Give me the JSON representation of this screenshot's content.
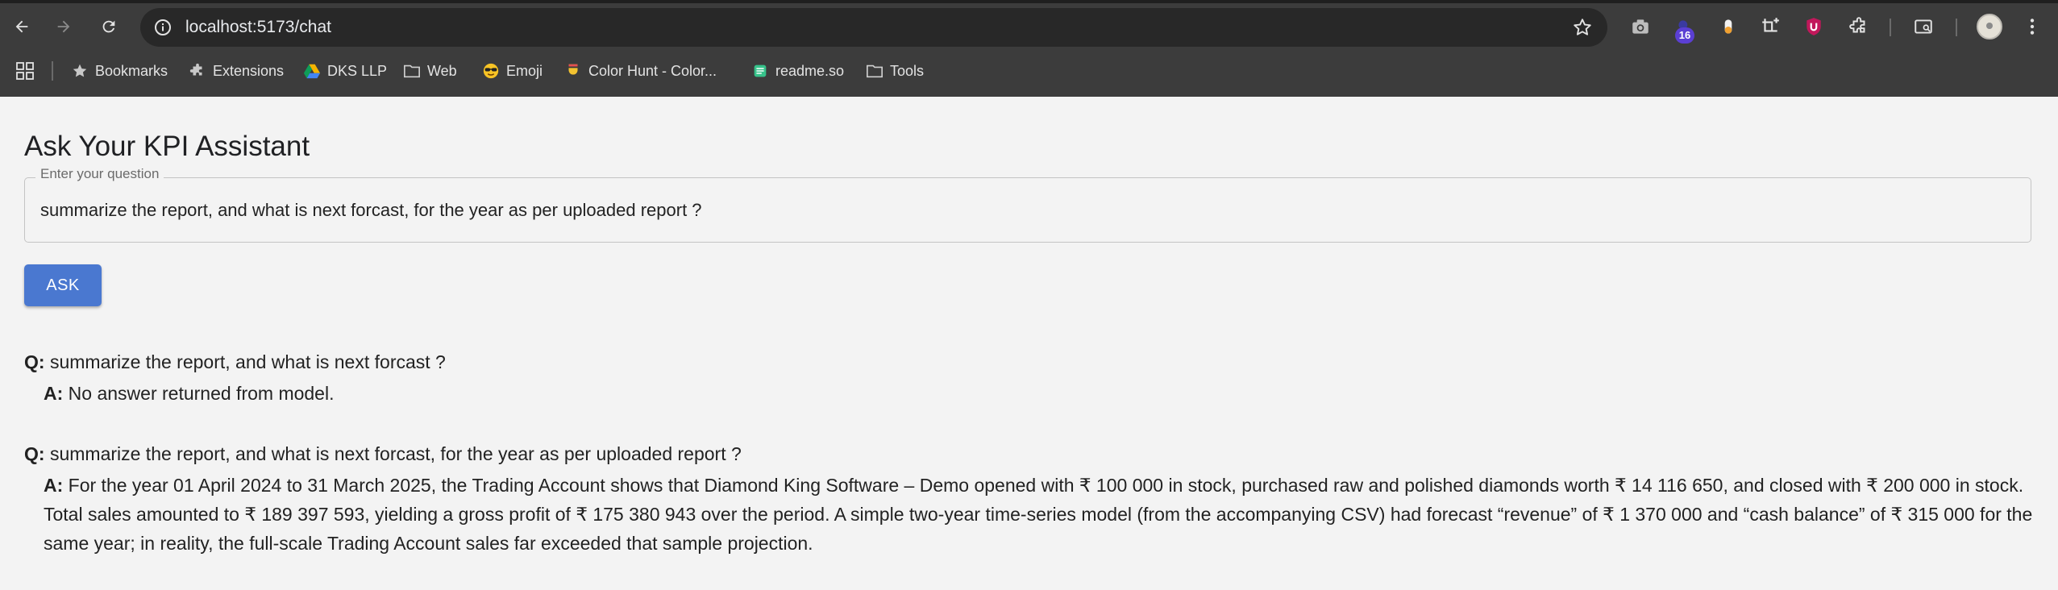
{
  "browser": {
    "url": "localhost:5173/chat",
    "extension_badge": "16",
    "bookmarks": [
      {
        "label": "Bookmarks",
        "icon": "star-icon"
      },
      {
        "label": "Extensions",
        "icon": "puzzle-icon"
      },
      {
        "label": "DKS LLP",
        "icon": "drive-icon"
      },
      {
        "label": "Web",
        "icon": "folder-icon"
      },
      {
        "label": "Emoji",
        "icon": "sunglasses-emoji-icon"
      },
      {
        "label": "Color Hunt - Color...",
        "icon": "colorhunt-icon"
      },
      {
        "label": "readme.so",
        "icon": "readme-icon"
      },
      {
        "label": "Tools",
        "icon": "folder-icon"
      }
    ]
  },
  "page": {
    "title": "Ask Your KPI Assistant",
    "question_label": "Enter your question",
    "question_value": "summarize the report, and what is next forcast, for the year as per uploaded report ?",
    "ask_label": "ASK"
  },
  "history": [
    {
      "q_prefix": "Q:",
      "question": "summarize the report, and what is next forcast ?",
      "a_prefix": "A:",
      "answer": "No answer returned from model."
    },
    {
      "q_prefix": "Q:",
      "question": "summarize the report, and what is next forcast, for the year as per uploaded report ?",
      "a_prefix": "A:",
      "answer": "For the year 01 April 2024 to 31 March 2025, the Trading Account shows that Diamond King Software – Demo opened with ₹ 100 000 in stock, purchased raw and polished diamonds worth ₹ 14 116 650, and closed with ₹ 200 000 in stock. Total sales amounted to ₹ 189 397 593, yielding a gross profit of ₹ 175 380 943 over the period. A simple two-year time-series model (from the accompanying CSV) had forecast “revenue” of ₹ 1 370 000 and “cash balance” of ₹ 315 000 for the same year; in reality, the full-scale Trading Account sales far exceeded that sample projection."
    }
  ]
}
